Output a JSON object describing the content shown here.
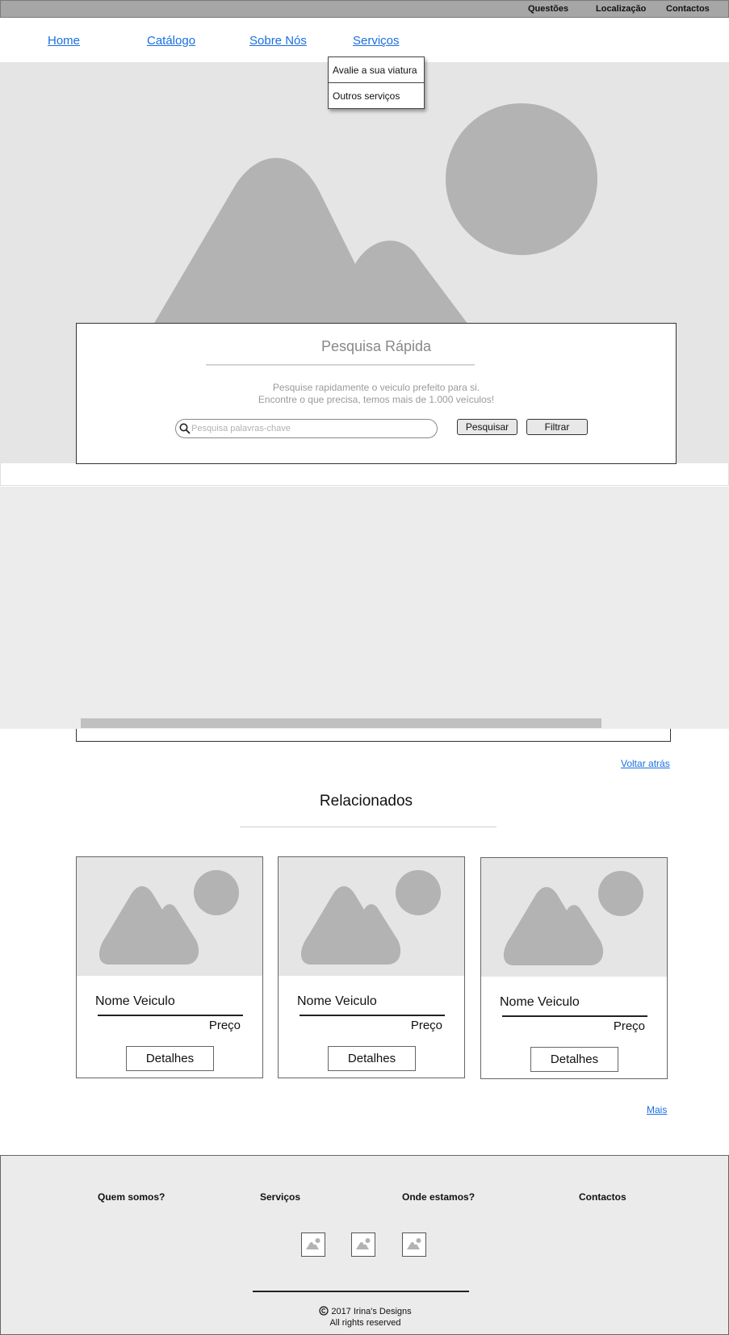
{
  "topbar": {
    "links": [
      "Questões",
      "Localização",
      "Contactos"
    ]
  },
  "nav": {
    "items": [
      "Home",
      "Catálogo",
      "Sobre Nós",
      "Serviços"
    ],
    "dropdown": [
      "Avalie a sua viatura",
      "Outros serviços"
    ]
  },
  "search": {
    "title": "Pesquisa Rápida",
    "subtitle_line1": "Pesquise rapidamente o veiculo prefeito para si.",
    "subtitle_line2": "Encontre o que precisa, temos mais de 1.000 veículos!",
    "placeholder": "Pesquisa palavras-chave",
    "value": "",
    "search_button": "Pesquisar",
    "filter_button": "Filtrar"
  },
  "back_link": "Voltar atrás",
  "related": {
    "title": "Relacionados",
    "cards": [
      {
        "name": "Nome Veiculo",
        "price": "Preço",
        "button": "Detalhes"
      },
      {
        "name": "Nome Veiculo",
        "price": "Preço",
        "button": "Detalhes"
      },
      {
        "name": "Nome Veiculo",
        "price": "Preço",
        "button": "Detalhes"
      }
    ],
    "more_link": "Mais"
  },
  "footer": {
    "columns": [
      "Quem somos?",
      "Serviços",
      "Onde estamos?",
      "Contactos"
    ],
    "copyright": "2017 Irina's Designs",
    "rights": "All rights reserved"
  },
  "colors": {
    "link": "#1a6fe0",
    "placeholder_gray": "#b3b3b3",
    "placeholder_bg": "#e5e5e5"
  }
}
